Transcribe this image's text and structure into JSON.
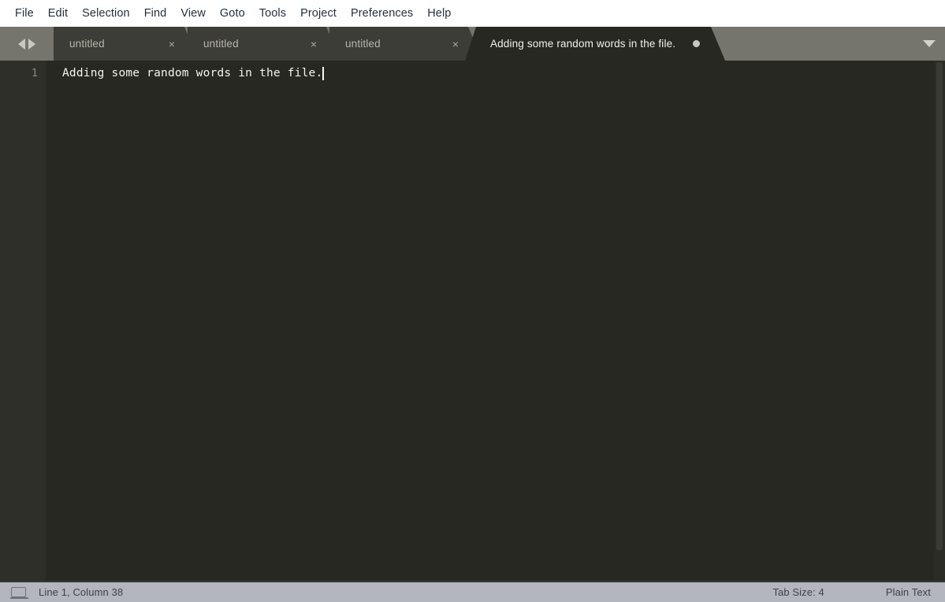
{
  "app": {
    "name": "Sublime Text",
    "theme_colors": {
      "menubar_bg": "#ffffff",
      "menubar_text": "#24313c",
      "tabbar_bg": "#75756d",
      "tab_inactive_bg": "#3d3d37",
      "tab_active_bg": "#272822",
      "editor_bg": "#272822",
      "gutter_bg": "#2e2f28",
      "code_text": "#f4f4ee",
      "statusbar_bg": "#b3b6bc",
      "statusbar_text": "#3e4348"
    }
  },
  "menubar": {
    "items": [
      {
        "label": "File"
      },
      {
        "label": "Edit"
      },
      {
        "label": "Selection"
      },
      {
        "label": "Find"
      },
      {
        "label": "View"
      },
      {
        "label": "Goto"
      },
      {
        "label": "Tools"
      },
      {
        "label": "Project"
      },
      {
        "label": "Preferences"
      },
      {
        "label": "Help"
      }
    ]
  },
  "tabbar": {
    "nav_prev_icon": "triangle-left-icon",
    "nav_next_icon": "triangle-right-icon",
    "dropdown_icon": "caret-down-icon",
    "close_glyph": "×",
    "ghost_text": "untitled",
    "tabs": [
      {
        "label": "untitled",
        "active": false,
        "dirty": false,
        "close_glyph": "×"
      },
      {
        "label": "untitled",
        "active": false,
        "dirty": false,
        "close_glyph": "×"
      },
      {
        "label": "untitled",
        "active": false,
        "dirty": false,
        "close_glyph": "×"
      },
      {
        "label": "Adding some random words in the file.",
        "active": true,
        "dirty": true,
        "close_glyph": "×"
      }
    ]
  },
  "editor": {
    "lines": [
      {
        "number": "1",
        "text": "Adding some random words in the file."
      }
    ]
  },
  "statusbar": {
    "icon": "laptop-icon",
    "position": "Line 1, Column 38",
    "tab_size": "Tab Size: 4",
    "syntax": "Plain Text"
  }
}
